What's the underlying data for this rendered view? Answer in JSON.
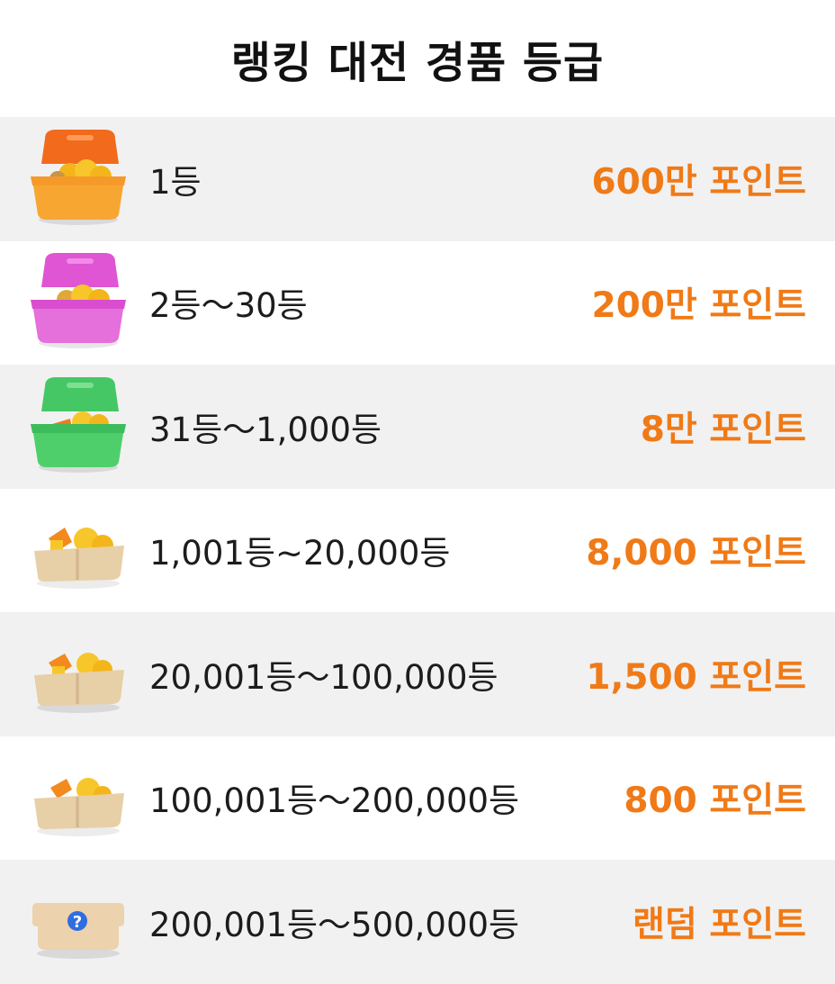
{
  "header": {
    "title": "랭킹 대전 경품 등급"
  },
  "tiers": [
    {
      "rank": "1등",
      "reward": "600만 포인트",
      "icon": "orange-lunchbox-coins-icon",
      "color": "#f5832a"
    },
    {
      "rank": "2등～30등",
      "reward": "200만 포인트",
      "icon": "pink-lunchbox-coins-icon",
      "color": "#e559d6"
    },
    {
      "rank": "31등～1,000등",
      "reward": "8만 포인트",
      "icon": "green-lunchbox-coins-icon",
      "color": "#3ec65a"
    },
    {
      "rank": "1,001등~20,000등",
      "reward": "8,000 포인트",
      "icon": "tray-coins-icon",
      "color": "#e8cfa6"
    },
    {
      "rank": "20,001등～100,000등",
      "reward": "1,500 포인트",
      "icon": "tray-coins-icon",
      "color": "#e8cfa6"
    },
    {
      "rank": "100,001등～200,000등",
      "reward": "800 포인트",
      "icon": "tray-coins-icon",
      "color": "#e8cfa6"
    },
    {
      "rank": "200,001등～500,000등",
      "reward": "랜덤 포인트",
      "icon": "mystery-box-icon",
      "color": "#ecd2ad"
    }
  ]
}
